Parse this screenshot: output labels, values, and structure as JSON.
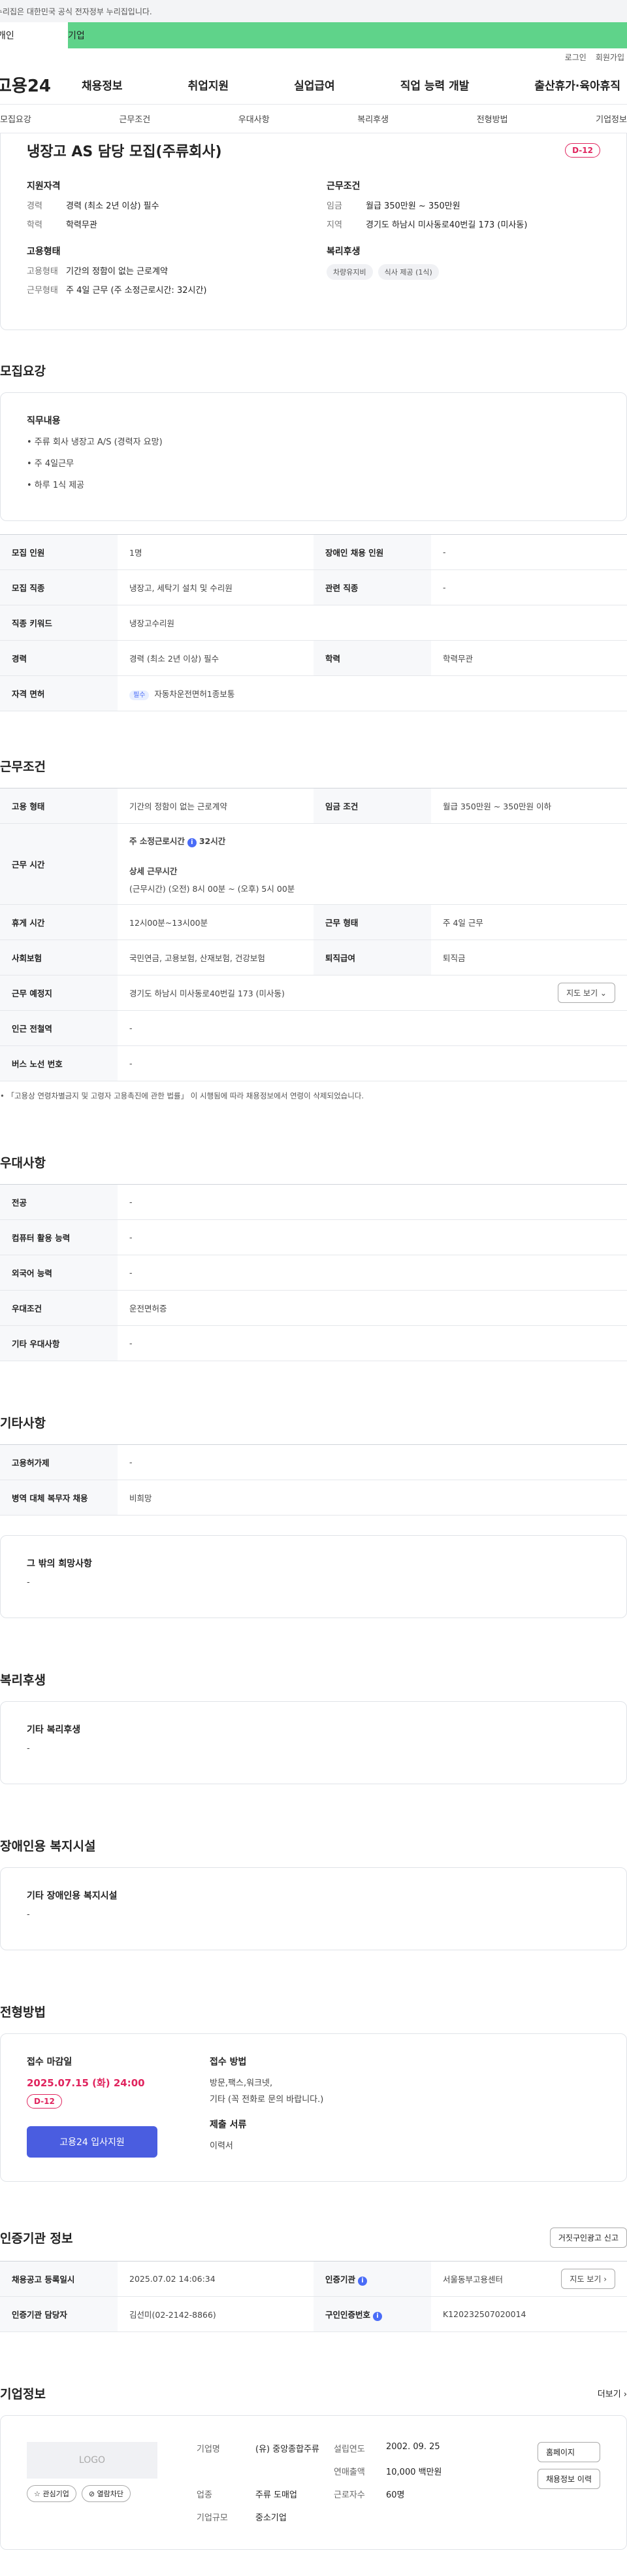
{
  "gov_notice": "이 누리집은 대한민국 공식 전자정부 누리집입니다.",
  "role_tabs": [
    "개인",
    "기업"
  ],
  "util": [
    "로그인",
    "회원가입"
  ],
  "logo": "고용24",
  "gnb": [
    "채용정보",
    "취업지원",
    "실업급여",
    "직업 능력 개발",
    "출산휴가·육아휴직"
  ],
  "subnav": [
    "모집요강",
    "근무조건",
    "우대사항",
    "복리후생",
    "전형방법",
    "기업정보"
  ],
  "summary": {
    "title": "냉장고 AS 담당 모집(주류회사)",
    "dday": "D-12",
    "qual_h": "지원자격",
    "qual": [
      {
        "k": "경력",
        "v": "경력 (최소 2년 이상) 필수"
      },
      {
        "k": "학력",
        "v": "학력무관"
      }
    ],
    "emp_h": "고용형태",
    "emp": [
      {
        "k": "고용형태",
        "v": "기간의 정함이 없는 근로계약"
      },
      {
        "k": "근무형태",
        "v": "주 4일 근무 (주 소정근로시간: 32시간)"
      }
    ],
    "cond_h": "근무조건",
    "cond": [
      {
        "k": "임금",
        "v": "월급 350만원 ~ 350만원"
      },
      {
        "k": "지역",
        "v": "경기도 하남시 미사동로40번길 173 (미사동)"
      }
    ],
    "welfare_h": "복리후생",
    "welfare_chips": [
      "차량유지비",
      "식사 제공 (1식)"
    ]
  },
  "recruit": {
    "title": "모집요강",
    "duty_h": "직무내용",
    "duties": [
      "• 주류 회사 냉장고 A/S (경력자 요망)",
      "• 주 4일근무",
      "• 하루 1식 제공"
    ],
    "rows": [
      {
        "k1": "모집 인원",
        "v1": "1명",
        "k2": "장애인 채용 인원",
        "v2": "-"
      },
      {
        "k1": "모집 직종",
        "v1": "냉장고, 세탁기 설치 및 수리원",
        "k2": "관련 직종",
        "v2": "-"
      }
    ],
    "keyword_k": "직종 키워드",
    "keyword_v": "냉장고수리원",
    "career_k": "경력",
    "career_v": "경력 (최소 2년 이상) 필수",
    "edu_k": "학력",
    "edu_v": "학력무관",
    "license_k": "자격 면허",
    "license_tag": "필수",
    "license_v": "자동차운전면허1종보통"
  },
  "work": {
    "title": "근무조건",
    "type_k": "고용 형태",
    "type_v": "기간의 정함이 없는 근로계약",
    "wage_k": "임금 조건",
    "wage_v": "월급 350만원 ~ 350만원 이하",
    "hours_k": "근무 시간",
    "hours_a": "주 소정근로시간",
    "hours_b": "32시간",
    "hours_c": "상세 근무시간",
    "hours_d": "(근무시간) (오전) 8시 00분 ~ (오후) 5시 00분",
    "rest_k": "휴게 시간",
    "rest_v": "12시00분~13시00분",
    "form_k": "근무 형태",
    "form_v": "주 4일 근무",
    "ins_k": "사회보험",
    "ins_v": "국민연금, 고용보험, 산재보험, 건강보험",
    "ret_k": "퇴직급여",
    "ret_v": "퇴직금",
    "place_k": "근무 예정지",
    "place_v": "경기도 하남시 미사동로40번길 173 (미사동)",
    "map_btn": "지도 보기 ⌄",
    "station_k": "인근 전철역",
    "station_v": "-",
    "bus_k": "버스 노선 번호",
    "bus_v": "-",
    "note": "• 「고용상 연령차별금지 및 고령자 고용촉진에 관한 법률」 이 시행됨에 따라 채용정보에서 연령이 삭제되었습니다."
  },
  "pref": {
    "title": "우대사항",
    "rows": [
      {
        "k": "전공",
        "v": "-"
      },
      {
        "k": "컴퓨터 활용 능력",
        "v": "-"
      },
      {
        "k": "외국어 능력",
        "v": "-"
      },
      {
        "k": "우대조건",
        "v": "운전면허증"
      },
      {
        "k": "기타 우대사항",
        "v": "-"
      }
    ]
  },
  "etc": {
    "title": "기타사항",
    "rows": [
      {
        "k": "고용허가제",
        "v": "-"
      },
      {
        "k": "병역 대체 복무자 채용",
        "v": "비희망"
      }
    ],
    "hope_h": "그 밖의 희망사항",
    "hope_v": "-"
  },
  "welfare": {
    "title": "복리후생",
    "h": "기타 복리후생",
    "v": "-"
  },
  "disab": {
    "title": "장애인용 복지시설",
    "h": "기타 장애인용 복지시설",
    "v": "-"
  },
  "process": {
    "title": "전형방법",
    "deadline_h": "접수 마감일",
    "deadline": "2025.07.15 (화) 24:00",
    "dday": "D-12",
    "apply_btn": "고용24 입사지원",
    "method_h": "접수 방법",
    "method_1": "방문,팩스,워크넷,",
    "method_2": "기타 (꼭 전화로 문의 바랍니다.)",
    "docs_h": "제출 서류",
    "docs": "이력서"
  },
  "cert": {
    "title": "인증기관 정보",
    "report_btn": "거짓구인광고 신고",
    "reg_k": "채용공고 등록일시",
    "reg_v": "2025.07.02 14:06:34",
    "org_k": "인증기관",
    "org_v": "서울동부고용센터",
    "map_btn": "지도 보기 ›",
    "mgr_k": "인증기관 담당자",
    "mgr_v": "김선미(02-2142-8866)",
    "num_k": "구인인증번호",
    "num_v": "K120232507020014"
  },
  "company": {
    "title": "기업정보",
    "more": "더보기 ›",
    "logo_text": "LOGO",
    "fav_btn": "☆ 관심기업",
    "block_btn": "⊘ 열람차단",
    "name_k": "기업명",
    "name_v": "(유) 중앙종합주류",
    "found_k": "설립연도",
    "found_v": "2002. 09. 25",
    "sales_k": "연매출액",
    "sales_v": "10,000 백만원",
    "ind_k": "업종",
    "ind_v": "주류 도매업",
    "emp_k": "근로자수",
    "emp_v": "60명",
    "size_k": "기업규모",
    "size_v": "중소기업",
    "home_btn": "홈페이지",
    "hist_btn": "채용정보 이력"
  }
}
